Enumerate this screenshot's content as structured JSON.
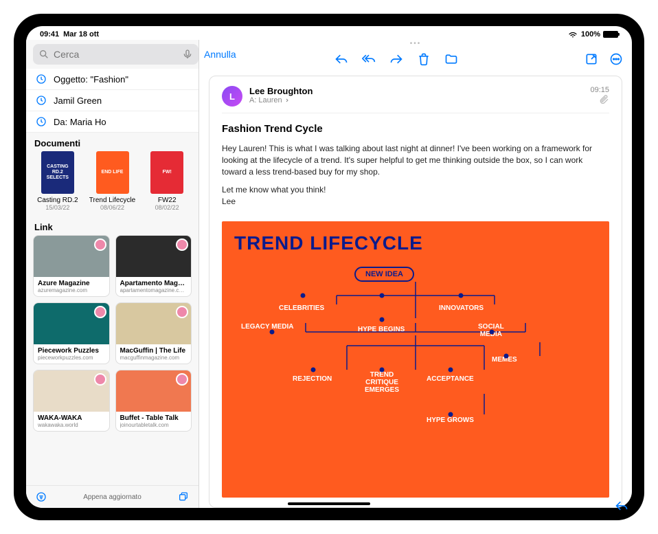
{
  "status": {
    "time": "09:41",
    "date": "Mar 18 ott",
    "battery_pct": "100%",
    "battery_fill": 100
  },
  "search": {
    "placeholder": "Cerca",
    "cancel": "Annulla"
  },
  "suggestions": [
    {
      "label": "Oggetto: \"Fashion\""
    },
    {
      "label": "Jamil Green"
    },
    {
      "label": "Da: Maria Ho"
    }
  ],
  "docs_header": "Documenti",
  "docs": [
    {
      "name": "Casting RD.2",
      "date": "15/03/22",
      "thumb_text": "CASTING RD.2 SELECTS",
      "thumb_bg": "#1a2a7a"
    },
    {
      "name": "Trend Lifecycle",
      "date": "08/06/22",
      "thumb_text": "END LIFE",
      "thumb_bg": "#ff5b1f"
    },
    {
      "name": "FW22",
      "date": "08/02/22",
      "thumb_text": "FW!",
      "thumb_bg": "#e52b35"
    }
  ],
  "links_header": "Link",
  "links": [
    {
      "title": "Azure Magazine",
      "url": "azuremagazine.com",
      "bg": "#8a9a9a"
    },
    {
      "title": "Apartamento Maga…",
      "url": "apartamentomagazine.c…",
      "bg": "#2b2b2b"
    },
    {
      "title": "Piecework Puzzles",
      "url": "pieceworkpuzzles.com",
      "bg": "#0e6b6b"
    },
    {
      "title": "MacGuffin | The Life",
      "url": "macguffinmagazine.com",
      "bg": "#d8c8a0"
    },
    {
      "title": "WAKA-WAKA",
      "url": "wakawaka.world",
      "bg": "#e8dcc8"
    },
    {
      "title": "Buffet - Table Talk",
      "url": "joinourtabletalk.com",
      "bg": "#f07850"
    }
  ],
  "sidebar_footer": "Appena aggiornato",
  "message": {
    "sender": "Lee Broughton",
    "to_label": "A:",
    "to_name": "Lauren",
    "time": "09:15",
    "subject": "Fashion Trend Cycle",
    "body_p1": "Hey Lauren! This is what I was talking about last night at dinner! I've been working on a framework for looking at the lifecycle of a trend. It's super helpful to get me thinking outside the box, so I can work toward a less trend-based buy for my shop.",
    "body_p2": "Let me know what you think!",
    "body_p3": "Lee"
  },
  "attachment": {
    "title": "TREND LIFECYCLE",
    "nodes": {
      "new_idea": "NEW IDEA",
      "celebrities": "CELEBRITIES",
      "innovators": "INNOVATORS",
      "legacy_media": "LEGACY MEDIA",
      "hype_begins": "HYPE BEGINS",
      "social_media": "SOCIAL MEDIA",
      "memes": "MEMES",
      "rejection": "REJECTION",
      "trend_critique": "TREND CRITIQUE EMERGES",
      "acceptance": "ACCEPTANCE",
      "hype_grows": "HYPE GROWS"
    }
  }
}
